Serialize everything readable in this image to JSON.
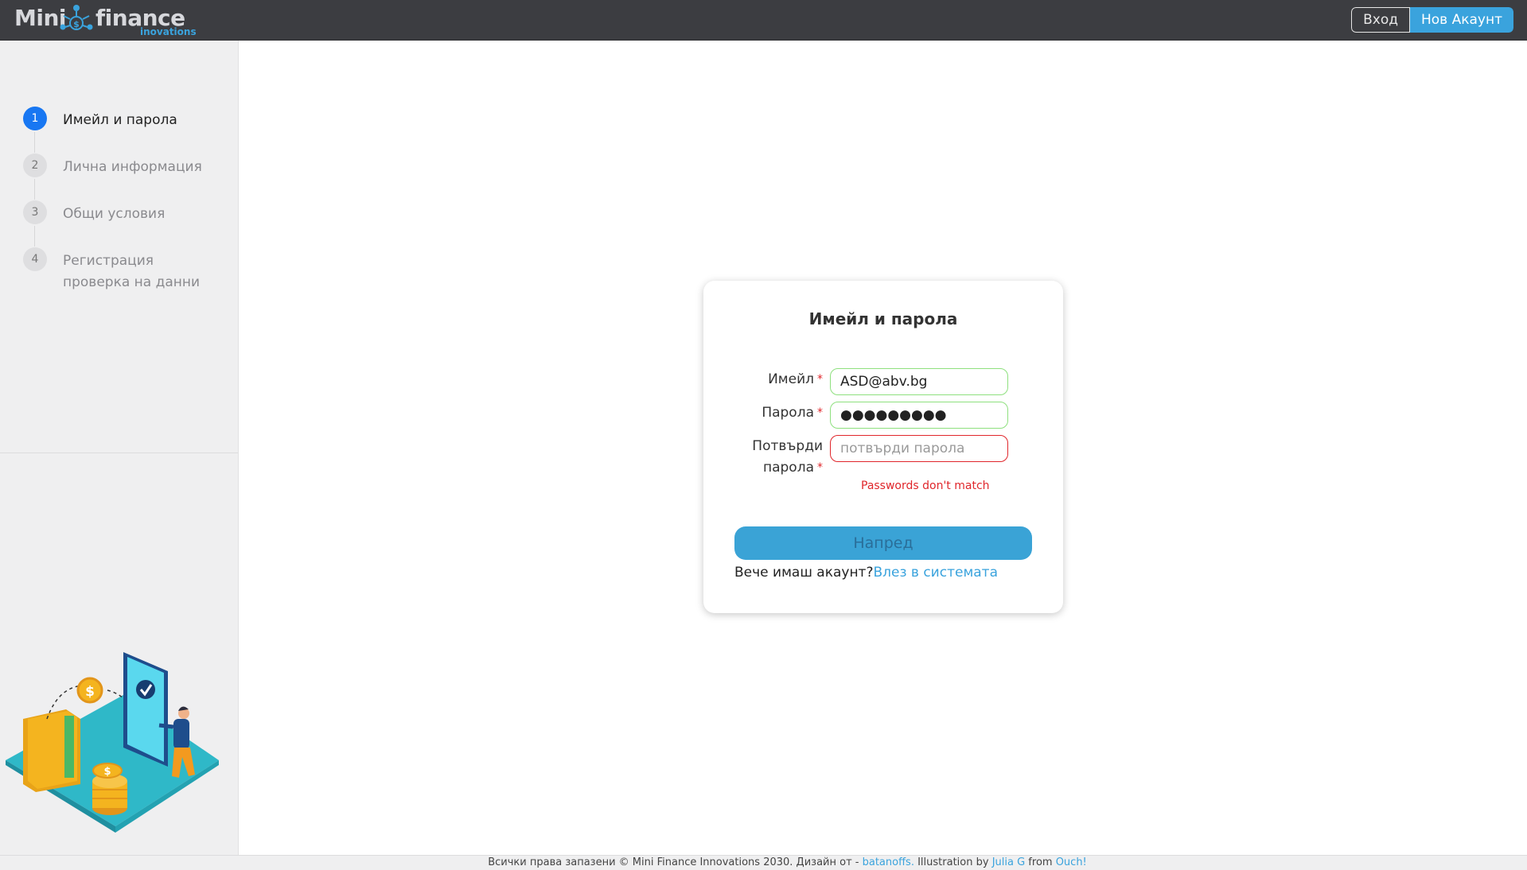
{
  "brand": {
    "word_left": "Mini",
    "word_right": "finance",
    "subtitle": "inovations",
    "accent": "#3aa3dd",
    "logo_icon": "coin-network-icon"
  },
  "nav": {
    "login_label": "Вход",
    "signup_label": "Нов Акаунт"
  },
  "steps": [
    {
      "number": "1",
      "label": "Имейл и парола",
      "active": true
    },
    {
      "number": "2",
      "label": "Лична информация",
      "active": false
    },
    {
      "number": "3",
      "label": "Общи условия",
      "active": false
    },
    {
      "number": "4",
      "label": "Регистрация проверка на данни",
      "active": false
    }
  ],
  "form": {
    "title": "Имейл и парола",
    "email_label": "Имейл",
    "email_value": "ASD@abv.bg",
    "password_label": "Парола",
    "password_value": "●●●●●●●●●",
    "confirm_label_line1": "Потвърди",
    "confirm_label_line2": "парола",
    "confirm_placeholder": "потвърди парола",
    "required_mark": "*",
    "error": "Passwords don't match",
    "next_label": "Напред",
    "have_account": "Вече имаш акаунт?",
    "login_link": "Влез в системата"
  },
  "colors": {
    "valid_border": "#8ee07e",
    "error": "#e0262b",
    "active_step": "#1877f2",
    "primary_button": "#3aa3d6"
  },
  "footer": {
    "text": "Всички права запазени © Mini Finance Innovations 2030. Дизайн от - ",
    "designer_link": "batanoffs.",
    "illustration_text": " Illustration by ",
    "artist_link": "Julia G",
    "from_text": " from ",
    "source_link": "Ouch!"
  }
}
